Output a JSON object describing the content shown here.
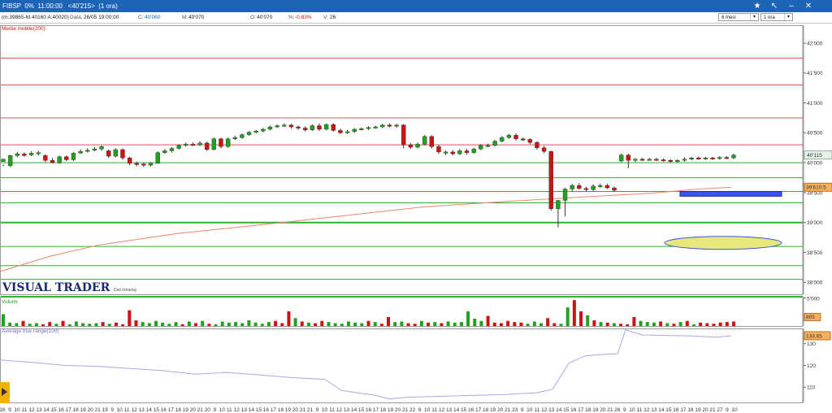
{
  "window": {
    "title": "FIBSP  0%  11:00:00   <40'215>  (1 ora)"
  },
  "toolbar": {
    "period_label": "6 mesi",
    "timeframe_label": "1 ora"
  },
  "infobar": {
    "range": "(m.39865-M.40160 A:40020)",
    "data_label": "Data:",
    "data_value": "26/05 19:00:00",
    "c_label": "C:",
    "c_value": "40'060",
    "m_label": "M:",
    "m_value": "40'070",
    "o_label": "O:",
    "o_value": "40'070",
    "pct_label": "%:",
    "pct_value": "-0.83%",
    "v_label": "V:",
    "v_value": "26"
  },
  "colors": {
    "bull": "#1fa21f",
    "bear": "#cc1212",
    "ma": "#f08070",
    "atr": "#a8a8e8",
    "res_line": "#e05050",
    "sup_line": "#30b030",
    "title_bg": "#1d63b6"
  },
  "panels": {
    "price_indicator": "Media mobile(200)",
    "volume_label": "Volumi",
    "atr_label": "Average true range(100)",
    "watermark": "VISUAL TRADER",
    "watermark_sub": "Dati Intraday"
  },
  "chart_data": [
    {
      "type": "candlestick",
      "name": "price",
      "y_ticks": [
        "42'000",
        "41'500",
        "41'000",
        "40'500",
        "40'000",
        "39'500",
        "39'000",
        "38'500",
        "38'000"
      ],
      "ylim": [
        37800,
        42300
      ],
      "last_price_label": "40'115",
      "ma_value_label": "39'610.5",
      "horizontal_lines_resistance": [
        41750,
        41300,
        40750,
        40300
      ],
      "horizontal_lines_support": [
        40000,
        39750,
        39520,
        39330,
        39000,
        38600,
        38280,
        38050,
        37760
      ],
      "moving_average": [
        [
          0,
          38180
        ],
        [
          60,
          38430
        ],
        [
          120,
          38620
        ],
        [
          220,
          38820
        ],
        [
          320,
          38960
        ],
        [
          420,
          39110
        ],
        [
          520,
          39260
        ],
        [
          620,
          39350
        ],
        [
          720,
          39430
        ],
        [
          800,
          39490
        ],
        [
          860,
          39560
        ],
        [
          900,
          39590
        ]
      ],
      "candles": [
        [
          40020,
          40060,
          39970,
          39940
        ],
        [
          39950,
          40120,
          40130,
          39930
        ],
        [
          40120,
          40150,
          40180,
          40090
        ],
        [
          40150,
          40120,
          40170,
          40100
        ],
        [
          40130,
          40160,
          40190,
          40110
        ],
        [
          40150,
          40170,
          40200,
          40120
        ],
        [
          40120,
          40040,
          40140,
          40010
        ],
        [
          40040,
          40000,
          40080,
          39990
        ],
        [
          40000,
          40100,
          40120,
          39980
        ],
        [
          40100,
          40050,
          40120,
          40030
        ],
        [
          40050,
          40160,
          40180,
          40030
        ],
        [
          40160,
          40190,
          40220,
          40150
        ],
        [
          40190,
          40210,
          40240,
          40170
        ],
        [
          40210,
          40230,
          40260,
          40190
        ],
        [
          40230,
          40270,
          40290,
          40200
        ],
        [
          40200,
          40110,
          40220,
          40080
        ],
        [
          40110,
          40220,
          40240,
          40090
        ],
        [
          40220,
          40080,
          40240,
          40050
        ],
        [
          40080,
          39990,
          40100,
          39960
        ],
        [
          39990,
          39980,
          40020,
          39940
        ],
        [
          39980,
          39960,
          40000,
          39930
        ],
        [
          39960,
          39990,
          40010,
          39940
        ],
        [
          39990,
          40170,
          40190,
          39980
        ],
        [
          40170,
          40200,
          40230,
          40150
        ],
        [
          40200,
          40240,
          40260,
          40170
        ],
        [
          40240,
          40290,
          40310,
          40220
        ],
        [
          40290,
          40310,
          40340,
          40270
        ],
        [
          40310,
          40300,
          40340,
          40280
        ],
        [
          40300,
          40330,
          40360,
          40280
        ],
        [
          40330,
          40220,
          40350,
          40200
        ],
        [
          40220,
          40400,
          40420,
          40210
        ],
        [
          40400,
          40270,
          40420,
          40240
        ],
        [
          40270,
          40400,
          40420,
          40250
        ],
        [
          40400,
          40420,
          40450,
          40380
        ],
        [
          40420,
          40470,
          40490,
          40400
        ],
        [
          40470,
          40510,
          40530,
          40450
        ],
        [
          40510,
          40530,
          40550,
          40490
        ],
        [
          40530,
          40560,
          40580,
          40510
        ],
        [
          40560,
          40600,
          40620,
          40540
        ],
        [
          40600,
          40620,
          40640,
          40580
        ],
        [
          40620,
          40630,
          40660,
          40600
        ],
        [
          40630,
          40600,
          40650,
          40570
        ],
        [
          40600,
          40580,
          40620,
          40550
        ],
        [
          40580,
          40550,
          40610,
          40520
        ],
        [
          40550,
          40620,
          40640,
          40530
        ],
        [
          40620,
          40560,
          40660,
          40530
        ],
        [
          40560,
          40640,
          40660,
          40540
        ],
        [
          40640,
          40540,
          40660,
          40520
        ],
        [
          40540,
          40500,
          40570,
          40480
        ],
        [
          40500,
          40520,
          40550,
          40480
        ],
        [
          40520,
          40560,
          40580,
          40500
        ],
        [
          40560,
          40570,
          40590,
          40540
        ],
        [
          40570,
          40590,
          40610,
          40550
        ],
        [
          40590,
          40600,
          40620,
          40570
        ],
        [
          40600,
          40630,
          40650,
          40580
        ],
        [
          40630,
          40610,
          40660,
          40590
        ],
        [
          40610,
          40630,
          40650,
          40590
        ],
        [
          40630,
          40300,
          40650,
          40240
        ],
        [
          40300,
          40260,
          40330,
          40230
        ],
        [
          40260,
          40310,
          40340,
          40240
        ],
        [
          40310,
          40440,
          40460,
          40290
        ],
        [
          40440,
          40270,
          40460,
          40240
        ],
        [
          40270,
          40180,
          40300,
          40150
        ],
        [
          40180,
          40180,
          40210,
          40130
        ],
        [
          40180,
          40150,
          40210,
          40120
        ],
        [
          40150,
          40200,
          40230,
          40130
        ],
        [
          40200,
          40170,
          40230,
          40140
        ],
        [
          40170,
          40230,
          40250,
          40150
        ],
        [
          40230,
          40290,
          40310,
          40210
        ],
        [
          40290,
          40290,
          40320,
          40260
        ],
        [
          40290,
          40360,
          40380,
          40270
        ],
        [
          40360,
          40420,
          40450,
          40340
        ],
        [
          40420,
          40460,
          40480,
          40400
        ],
        [
          40460,
          40400,
          40490,
          40370
        ],
        [
          40400,
          40390,
          40420,
          40360
        ],
        [
          40390,
          40340,
          40410,
          40310
        ],
        [
          40340,
          40250,
          40360,
          40220
        ],
        [
          40250,
          40190,
          40280,
          40160
        ],
        [
          40190,
          39230,
          40200,
          39200
        ],
        [
          39230,
          39370,
          39380,
          38920
        ],
        [
          39370,
          39560,
          39580,
          39100
        ],
        [
          39560,
          39620,
          39650,
          39520
        ],
        [
          39620,
          39570,
          39660,
          39550
        ],
        [
          39570,
          39550,
          39600,
          39520
        ],
        [
          39550,
          39610,
          39640,
          39530
        ],
        [
          39610,
          39620,
          39650,
          39580
        ],
        [
          39620,
          39580,
          39650,
          39560
        ],
        [
          39580,
          39540,
          39600,
          39510
        ],
        [
          40030,
          40130,
          40150,
          40010
        ],
        [
          40130,
          40040,
          40150,
          39910
        ],
        [
          40040,
          40060,
          40080,
          40010
        ],
        [
          40060,
          40050,
          40080,
          40030
        ],
        [
          40050,
          40060,
          40080,
          40030
        ],
        [
          40060,
          40050,
          40080,
          40030
        ],
        [
          40050,
          40040,
          40070,
          40020
        ],
        [
          40040,
          40020,
          40060,
          40000
        ],
        [
          40020,
          40040,
          40060,
          40000
        ],
        [
          40040,
          40060,
          40090,
          40020
        ],
        [
          40060,
          40080,
          40100,
          40040
        ],
        [
          40080,
          40070,
          40100,
          40050
        ],
        [
          40070,
          40080,
          40100,
          40050
        ],
        [
          40080,
          40070,
          40100,
          40050
        ],
        [
          40070,
          40090,
          40110,
          40050
        ],
        [
          40090,
          40080,
          40110,
          40060
        ],
        [
          40080,
          40130,
          40150,
          40060
        ]
      ]
    },
    {
      "type": "bar",
      "name": "Volumi",
      "y_ticks": [
        "5'000"
      ],
      "ylim": [
        0,
        5200
      ],
      "last_value_label": "805",
      "values": [
        2100,
        600,
        500,
        900,
        400,
        500,
        300,
        700,
        400,
        900,
        300,
        800,
        500,
        400,
        500,
        700,
        400,
        600,
        300,
        2800,
        1000,
        700,
        500,
        900,
        600,
        400,
        700,
        300,
        800,
        500,
        900,
        400,
        300,
        800,
        600,
        700,
        500,
        1000,
        600,
        400,
        700,
        900,
        500,
        2600,
        1400,
        800,
        600,
        500,
        900,
        700,
        500,
        400,
        800,
        600,
        500,
        900,
        700,
        400,
        1600,
        700,
        800,
        500,
        400,
        900,
        600,
        700,
        500,
        800,
        600,
        700,
        2600,
        1300,
        900,
        1800,
        600,
        500,
        900,
        700,
        600,
        400,
        800,
        500,
        1400,
        500,
        400,
        3300,
        4600,
        2600,
        1900,
        1000,
        700,
        600,
        500,
        400,
        300,
        1600,
        900,
        700,
        600,
        800,
        500,
        400,
        700,
        900,
        300,
        600,
        500,
        400,
        600,
        700,
        800
      ]
    },
    {
      "type": "line",
      "name": "Average true range(100)",
      "y_ticks": [
        "130",
        "120",
        "110"
      ],
      "ylim": [
        103,
        137
      ],
      "last_value_label": "133.65",
      "values": [
        [
          0,
          122.5
        ],
        [
          40,
          121.4
        ],
        [
          80,
          120
        ],
        [
          120,
          119.6
        ],
        [
          160,
          118.6
        ],
        [
          200,
          117.6
        ],
        [
          240,
          116
        ],
        [
          280,
          116.8
        ],
        [
          320,
          115.6
        ],
        [
          360,
          114.4
        ],
        [
          400,
          113.6
        ],
        [
          420,
          108.6
        ],
        [
          440,
          107.4
        ],
        [
          460,
          106.4
        ],
        [
          480,
          104.6
        ],
        [
          500,
          105.4
        ],
        [
          540,
          105.8
        ],
        [
          580,
          106.2
        ],
        [
          620,
          106.6
        ],
        [
          660,
          107.4
        ],
        [
          680,
          109
        ],
        [
          700,
          121
        ],
        [
          720,
          124.4
        ],
        [
          740,
          125
        ],
        [
          760,
          125.4
        ],
        [
          770,
          136.4
        ],
        [
          790,
          134
        ],
        [
          820,
          133.8
        ],
        [
          850,
          133.6
        ],
        [
          880,
          133
        ],
        [
          900,
          133.6
        ]
      ]
    }
  ],
  "xaxis": {
    "labels": [
      "16",
      "9",
      "10",
      "11",
      "12",
      "13",
      "14",
      "15",
      "16",
      "17",
      "18",
      "19",
      "20",
      "21",
      "19",
      "9",
      "10",
      "11",
      "12",
      "13",
      "14",
      "15",
      "16",
      "17",
      "18",
      "19",
      "20",
      "21",
      "20",
      "9",
      "10",
      "11",
      "12",
      "13",
      "14",
      "15",
      "16",
      "17",
      "18",
      "19",
      "20",
      "21",
      "21",
      "9",
      "10",
      "11",
      "12",
      "13",
      "14",
      "15",
      "16",
      "17",
      "18",
      "19",
      "20",
      "21",
      "22",
      "9",
      "10",
      "11",
      "12",
      "13",
      "14",
      "15",
      "16",
      "17",
      "18",
      "19",
      "20",
      "21",
      "23",
      "9",
      "10",
      "11",
      "12",
      "13",
      "14",
      "15",
      "16",
      "17",
      "18",
      "19",
      "20",
      "21",
      "26",
      "9",
      "10",
      "11",
      "12",
      "13",
      "14",
      "15",
      "16",
      "17",
      "18",
      "19",
      "20",
      "21",
      "27",
      "9",
      "10"
    ],
    "date_labels": [
      "16",
      "19",
      "20",
      "21",
      "22",
      "23",
      "26",
      "27"
    ]
  }
}
